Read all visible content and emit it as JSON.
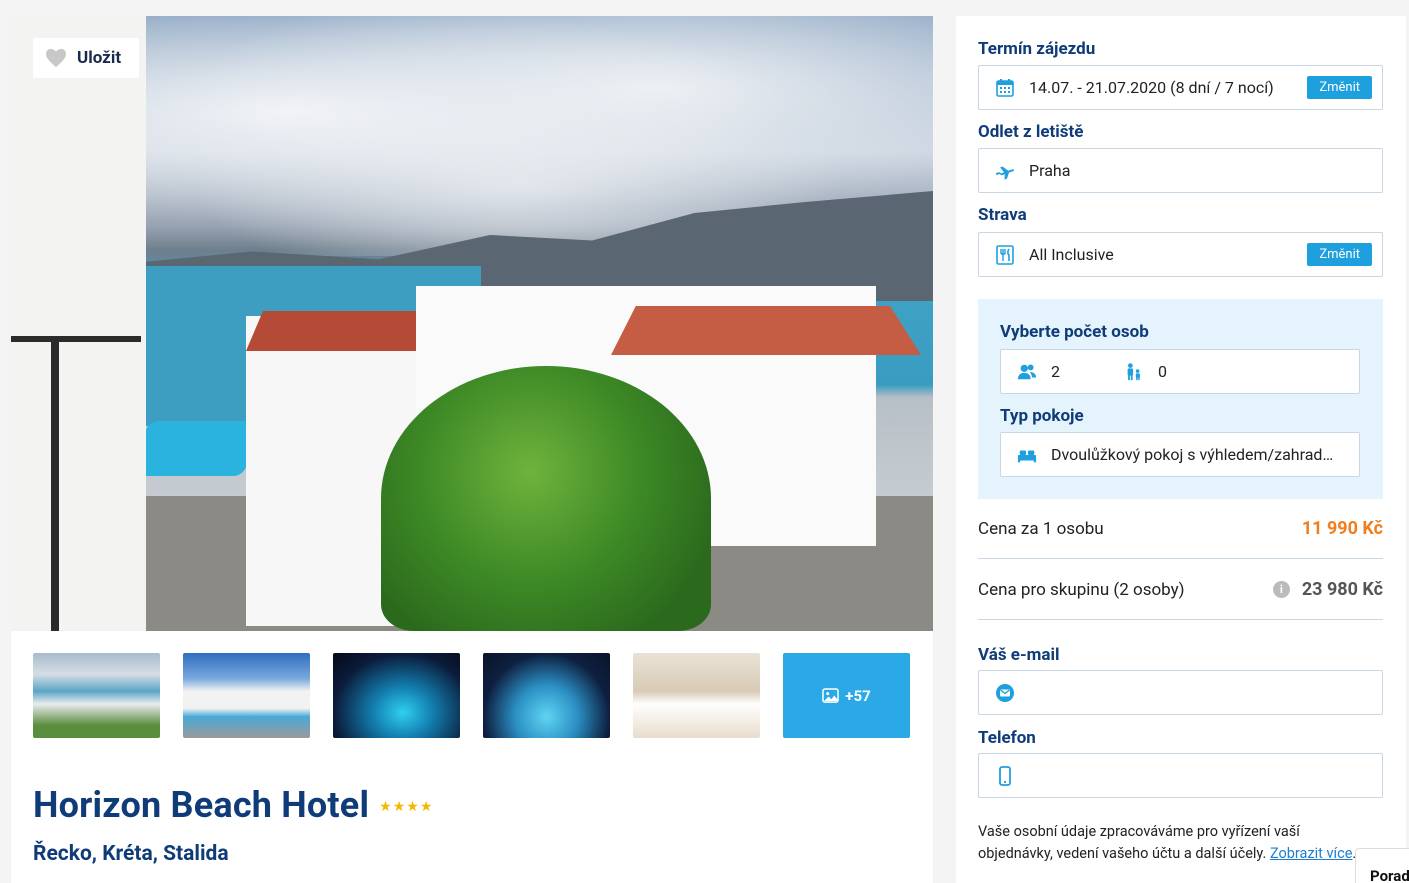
{
  "gallery": {
    "save_label": "Uložit",
    "more_photos_label": "+57",
    "thumbnails": [
      "pool-view",
      "hotel-pool",
      "night-pool",
      "night-pool-wide",
      "room"
    ]
  },
  "hotel": {
    "name": "Horizon Beach Hotel",
    "stars": "★★★★",
    "star_count": 4,
    "location": "Řecko, Kréta, Stalida"
  },
  "booking": {
    "term_label": "Termín zájezdu",
    "term_value": "14.07. - 21.07.2020 (8 dní / 7 nocí)",
    "change_label": "Změnit",
    "departure_label": "Odlet z letiště",
    "departure_value": "Praha",
    "meal_label": "Strava",
    "meal_value": "All Inclusive",
    "persons_label": "Vyberte počet osob",
    "adults": "2",
    "children": "0",
    "room_label": "Typ pokoje",
    "room_value": "Dvoulůžkový pokoj s výhledem/zahrada ...",
    "price_per_person_label": "Cena za 1 osobu",
    "price_per_person": "11 990 Kč",
    "price_group_label": "Cena pro skupinu (2 osoby)",
    "price_group": "23 980 Kč",
    "email_label": "Váš e-mail",
    "email_value": "",
    "phone_label": "Telefon",
    "phone_value": "",
    "privacy_text": "Vaše osobní údaje zpracováváme pro vyřízení vaší objednávky, vedení vašeho účtu a další účely.",
    "privacy_link": "Zobrazit více",
    "privacy_end": "."
  },
  "chat": {
    "label": "Porad"
  },
  "colors": {
    "brand_blue": "#0f3c78",
    "accent_blue": "#1ea0de",
    "price_orange": "#f07d1e",
    "light_panel": "#e4f3fc"
  }
}
